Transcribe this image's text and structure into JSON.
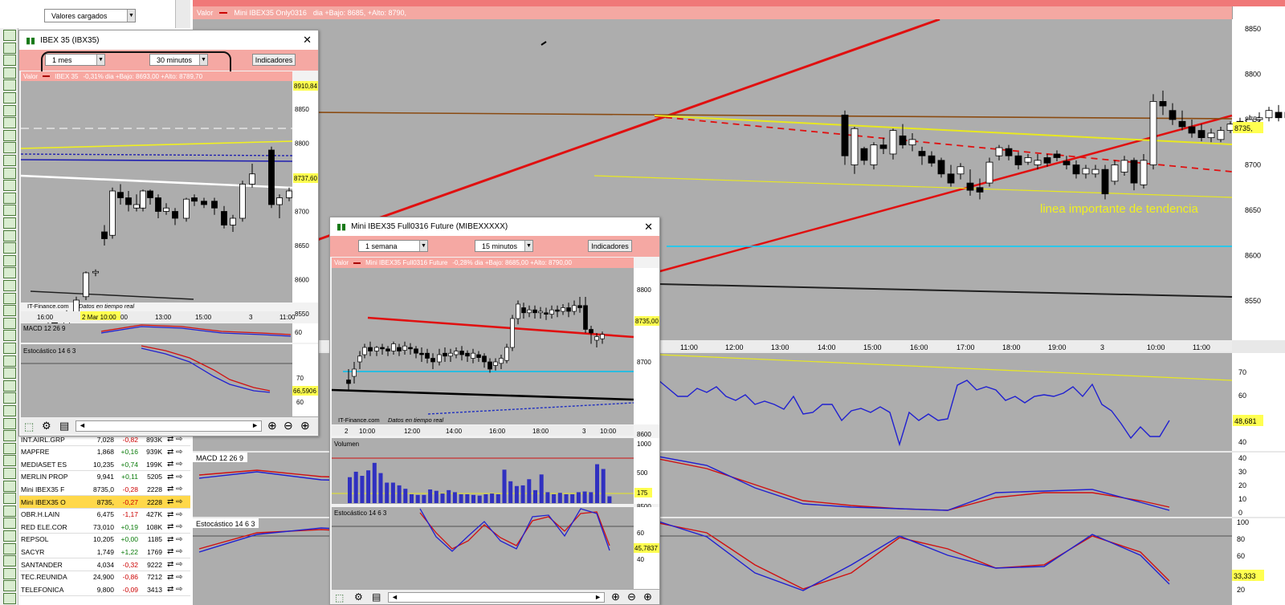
{
  "toolbar": {
    "dropdown": "Valores cargados"
  },
  "main": {
    "header": "Valor",
    "instrument": "Mini IBEX35 Only0316",
    "header_stats": "dia +Bajo: 8685, +Alto: 8790,",
    "annotation": "linea importante de tendencia",
    "price_tag": "8735,",
    "osc_tag": "48,681",
    "stoch_tag": "33,333",
    "y_ticks": [
      "8850",
      "8800",
      "8750",
      "8700",
      "8650",
      "8600",
      "8550"
    ],
    "x_ticks": [
      "11:00",
      "12:00",
      "13:00",
      "14:00",
      "15:00",
      "16:00",
      "17:00",
      "18:00",
      "19:00",
      "3",
      "10:00",
      "11:00"
    ],
    "osc_ticks": [
      "70",
      "60",
      "50",
      "40"
    ],
    "macd_label": "MACD 12 26 9",
    "macd_ticks": [
      "40",
      "30",
      "20",
      "10",
      "0"
    ],
    "stoch_label": "Estocástico 14 6 3",
    "stoch_ticks": [
      "100",
      "80",
      "60",
      "40",
      "20"
    ],
    "candles": [
      [
        812,
        8755,
        8710,
        8700,
        8760
      ],
      [
        824,
        8700,
        8740,
        8690,
        8742
      ],
      [
        836,
        8718,
        8705,
        8700,
        8720
      ],
      [
        848,
        8700,
        8722,
        8695,
        8725
      ],
      [
        860,
        8722,
        8718,
        8712,
        8730
      ],
      [
        872,
        8712,
        8738,
        8706,
        8740
      ],
      [
        884,
        8732,
        8722,
        8718,
        8745
      ],
      [
        896,
        8722,
        8728,
        8715,
        8735
      ],
      [
        908,
        8715,
        8710,
        8700,
        8720
      ],
      [
        920,
        8710,
        8702,
        8698,
        8715
      ],
      [
        932,
        8705,
        8690,
        8686,
        8708
      ],
      [
        944,
        8690,
        8680,
        8676,
        8700
      ],
      [
        956,
        8690,
        8698,
        8684,
        8702
      ],
      [
        968,
        8680,
        8672,
        8666,
        8695
      ],
      [
        980,
        8675,
        8670,
        8662,
        8685
      ],
      [
        992,
        8680,
        8703,
        8676,
        8708
      ],
      [
        1004,
        8710,
        8719,
        8705,
        8722
      ],
      [
        1016,
        8718,
        8710,
        8705,
        8722
      ],
      [
        1028,
        8710,
        8700,
        8695,
        8714
      ],
      [
        1040,
        8703,
        8708,
        8700,
        8712
      ],
      [
        1052,
        8700,
        8705,
        8695,
        8712
      ],
      [
        1064,
        8708,
        8702,
        8698,
        8712
      ],
      [
        1076,
        8712,
        8708,
        8704,
        8716
      ],
      [
        1088,
        8704,
        8700,
        8695,
        8710
      ],
      [
        1100,
        8700,
        8690,
        8685,
        8705
      ],
      [
        1112,
        8690,
        8696,
        8685,
        8700
      ],
      [
        1124,
        8690,
        8695,
        8686,
        8700
      ],
      [
        1136,
        8695,
        8668,
        8662,
        8700
      ],
      [
        1148,
        8682,
        8700,
        8678,
        8705
      ],
      [
        1160,
        8692,
        8705,
        8688,
        8710
      ],
      [
        1172,
        8705,
        8680,
        8672,
        8708
      ],
      [
        1184,
        8678,
        8705,
        8674,
        8712
      ],
      [
        1196,
        8700,
        8770,
        8695,
        8778
      ],
      [
        1208,
        8770,
        8765,
        8755,
        8782
      ],
      [
        1220,
        8760,
        8750,
        8744,
        8768
      ],
      [
        1232,
        8748,
        8742,
        8738,
        8760
      ],
      [
        1244,
        8742,
        8735,
        8730,
        8750
      ],
      [
        1256,
        8738,
        8730,
        8726,
        8745
      ],
      [
        1268,
        8730,
        8735,
        8725,
        8740
      ],
      [
        1280,
        8728,
        8738,
        8725,
        8742
      ],
      [
        1292,
        8738,
        8745,
        8735,
        8748
      ],
      [
        1304,
        8748,
        8745,
        8740,
        8752
      ],
      [
        1316,
        8745,
        8750,
        8740,
        8755
      ],
      [
        1328,
        8750,
        8752,
        8745,
        8758
      ],
      [
        1340,
        8752,
        8760,
        8748,
        8764
      ],
      [
        1352,
        8758,
        8752,
        8748,
        8766
      ],
      [
        1364,
        8752,
        8758,
        8748,
        8765
      ],
      [
        1376,
        8766,
        8748,
        8742,
        8790
      ],
      [
        1388,
        8748,
        8720,
        8700,
        8752
      ],
      [
        1400,
        8720,
        8712,
        8700,
        8726
      ],
      [
        1412,
        8710,
        8725,
        8705,
        8730
      ],
      [
        1424,
        8725,
        8720,
        8690,
        8728
      ],
      [
        1436,
        8715,
        8735,
        8712,
        8738
      ]
    ]
  },
  "sidebar": {
    "icons": 46,
    "rows": [
      {
        "name": "INT.AIRL.GRP",
        "price": "7,028",
        "chg": "-0,82",
        "vol": "893K"
      },
      {
        "name": "MAPFRE",
        "price": "1,868",
        "chg": "+0,16",
        "vol": "939K"
      },
      {
        "name": "MEDIASET ES",
        "price": "10,235",
        "chg": "+0,74",
        "vol": "199K"
      },
      {
        "name": "MERLIN PROP",
        "price": "9,941",
        "chg": "+0,11",
        "vol": "5205"
      },
      {
        "name": "Mini IBEX35 F",
        "price": "8735,0",
        "chg": "-0,28",
        "vol": "2228"
      },
      {
        "name": "Mini IBEX35 O",
        "price": "8735,",
        "chg": "-0,27",
        "vol": "2228"
      },
      {
        "name": "OBR.H.LAIN",
        "price": "6,475",
        "chg": "-1,17",
        "vol": "427K"
      },
      {
        "name": "RED ELE.COR",
        "price": "73,010",
        "chg": "+0,19",
        "vol": "108K"
      },
      {
        "name": "REPSOL",
        "price": "10,205",
        "chg": "+0,00",
        "vol": "1185"
      },
      {
        "name": "SACYR",
        "price": "1,749",
        "chg": "+1,22",
        "vol": "1769"
      },
      {
        "name": "SANTANDER",
        "price": "4,034",
        "chg": "-0,32",
        "vol": "9222"
      },
      {
        "name": "TEC.REUNIDA",
        "price": "24,900",
        "chg": "-0,86",
        "vol": "7212"
      },
      {
        "name": "TELEFONICA",
        "price": "9,800",
        "chg": "-0,09",
        "vol": "3413"
      }
    ]
  },
  "win1": {
    "title": "IBEX 35 (IBX35)",
    "period": "1 mes",
    "interval": "30 minutos",
    "indicators": "Indicadores",
    "header": "Valor",
    "instrument": "IBEX 35",
    "stats": "-0,31%  dia +Bajo: 8693,00 +Alto: 8789,70",
    "tag_top": "8910,84",
    "tag_price": "8737,60",
    "y_ticks": [
      "8850",
      "8800",
      "8750",
      "8700",
      "8650",
      "8600",
      "8550"
    ],
    "credit": "IT-Finance.com",
    "credit2": "Datos en tiempo real",
    "x_ticks": [
      "16:00",
      "2 Mar 10:00",
      "00",
      "13:00",
      "15:00",
      "3",
      "11:00"
    ],
    "macd_label": "MACD 12 26 9",
    "macd_tick": "60",
    "stoch_label": "Estocástico 14 6 3",
    "stoch_ticks": [
      "70",
      "60"
    ],
    "stoch_tag": "66,5906",
    "candles": [
      [
        34,
        8545,
        8540,
        8530,
        8550
      ],
      [
        42,
        8540,
        8535,
        8525,
        8545
      ],
      [
        57,
        8535,
        8550,
        8530,
        8555
      ],
      [
        69,
        8550,
        8570,
        8545,
        8575
      ],
      [
        81,
        8575,
        8610,
        8570,
        8612
      ],
      [
        93,
        8610,
        8612,
        8605,
        8615
      ],
      [
        104,
        8670,
        8660,
        8650,
        8680
      ],
      [
        114,
        8665,
        8730,
        8660,
        8735
      ],
      [
        124,
        8728,
        8720,
        8710,
        8740
      ],
      [
        134,
        8720,
        8710,
        8700,
        8730
      ],
      [
        144,
        8705,
        8710,
        8700,
        8725
      ],
      [
        152,
        8705,
        8730,
        8700,
        8732
      ],
      [
        161,
        8730,
        8720,
        8710,
        8732
      ],
      [
        171,
        8720,
        8700,
        8690,
        8725
      ],
      [
        181,
        8700,
        8705,
        8695,
        8712
      ],
      [
        192,
        8700,
        8690,
        8680,
        8705
      ],
      [
        206,
        8690,
        8718,
        8685,
        8720
      ],
      [
        216,
        8720,
        8715,
        8708,
        8725
      ],
      [
        228,
        8715,
        8710,
        8705,
        8720
      ],
      [
        241,
        8715,
        8705,
        8695,
        8720
      ],
      [
        253,
        8700,
        8680,
        8675,
        8708
      ],
      [
        264,
        8680,
        8690,
        8670,
        8695
      ],
      [
        276,
        8690,
        8740,
        8685,
        8745
      ],
      [
        288,
        8740,
        8755,
        8735,
        8770
      ],
      [
        312,
        8790,
        8710,
        8705,
        8795
      ],
      [
        322,
        8710,
        8720,
        8690,
        8725
      ],
      [
        334,
        8720,
        8730,
        8715,
        8735
      ]
    ]
  },
  "win2": {
    "title": "Mini IBEX35 Full0316 Future (MIBEXXXXX)",
    "period": "1 semana",
    "interval": "15 minutos",
    "indicators": "Indicadores",
    "header": "Valor",
    "instrument": "Mini IBEX35 Full0316 Future",
    "stats": "-0,28%  dia +Bajo: 8685,00 +Alto: 8790,00",
    "tag_price": "8735,00",
    "y_ticks": [
      "8800",
      "8700",
      "8600",
      "8500"
    ],
    "credit": "IT-Finance.com",
    "credit2": "Datos en tiempo real",
    "x_ticks": [
      "2",
      "10:00",
      "12:00",
      "14:00",
      "16:00",
      "18:00",
      "3",
      "10:00"
    ],
    "vol_label": "Volumen",
    "vol_ticks": [
      "1000",
      "500",
      "175"
    ],
    "volumes": [
      380,
      460,
      400,
      480,
      590,
      440,
      300,
      300,
      260,
      210,
      130,
      120,
      120,
      200,
      180,
      140,
      190,
      160,
      130,
      130,
      120,
      110,
      130,
      140,
      130,
      490,
      320,
      250,
      260,
      350,
      190,
      420,
      160,
      130,
      150,
      130,
      130,
      160,
      170,
      160,
      570,
      500,
      100
    ],
    "stoch_label": "Estocástico 14 6 3",
    "stoch_ticks": [
      "60",
      "40"
    ],
    "stoch_tag": "45,7837",
    "candles": [
      [
        433,
        8675,
        8670,
        8660,
        8690
      ],
      [
        440,
        8680,
        8690,
        8670,
        8700
      ],
      [
        447,
        8700,
        8708,
        8690,
        8715
      ],
      [
        453,
        8710,
        8720,
        8705,
        8725
      ],
      [
        460,
        8720,
        8715,
        8708,
        8728
      ],
      [
        468,
        8715,
        8720,
        8708,
        8722
      ],
      [
        475,
        8720,
        8718,
        8710,
        8725
      ],
      [
        482,
        8718,
        8715,
        8708,
        8722
      ],
      [
        489,
        8715,
        8725,
        8710,
        8728
      ],
      [
        496,
        8720,
        8715,
        8708,
        8725
      ],
      [
        503,
        8716,
        8722,
        8710,
        8728
      ],
      [
        510,
        8720,
        8718,
        8710,
        8726
      ],
      [
        517,
        8718,
        8712,
        8705,
        8722
      ],
      [
        524,
        8712,
        8710,
        8700,
        8720
      ],
      [
        531,
        8712,
        8705,
        8698,
        8718
      ],
      [
        538,
        8705,
        8700,
        8690,
        8712
      ],
      [
        546,
        8700,
        8710,
        8695,
        8718
      ],
      [
        553,
        8712,
        8708,
        8700,
        8720
      ],
      [
        560,
        8708,
        8712,
        8700,
        8718
      ],
      [
        567,
        8710,
        8715,
        8705,
        8720
      ],
      [
        574,
        8715,
        8710,
        8702,
        8722
      ],
      [
        581,
        8712,
        8708,
        8700,
        8716
      ],
      [
        588,
        8705,
        8712,
        8698,
        8718
      ],
      [
        595,
        8710,
        8706,
        8700,
        8715
      ],
      [
        602,
        8708,
        8700,
        8692,
        8712
      ],
      [
        609,
        8700,
        8690,
        8685,
        8705
      ],
      [
        616,
        8695,
        8700,
        8688,
        8705
      ],
      [
        623,
        8698,
        8705,
        8690,
        8710
      ],
      [
        630,
        8702,
        8720,
        8698,
        8725
      ],
      [
        637,
        8720,
        8760,
        8715,
        8765
      ],
      [
        644,
        8760,
        8780,
        8752,
        8785
      ],
      [
        651,
        8775,
        8768,
        8760,
        8782
      ],
      [
        658,
        8768,
        8772,
        8762,
        8778
      ],
      [
        665,
        8772,
        8768,
        8760,
        8778
      ],
      [
        672,
        8768,
        8770,
        8760,
        8776
      ],
      [
        679,
        8768,
        8766,
        8758,
        8775
      ],
      [
        686,
        8766,
        8772,
        8760,
        8778
      ],
      [
        693,
        8772,
        8770,
        8762,
        8778
      ],
      [
        700,
        8770,
        8775,
        8765,
        8780
      ],
      [
        707,
        8775,
        8770,
        8762,
        8782
      ],
      [
        714,
        8770,
        8778,
        8765,
        8785
      ],
      [
        721,
        8778,
        8775,
        8768,
        8790
      ],
      [
        728,
        8778,
        8745,
        8740,
        8790
      ],
      [
        735,
        8745,
        8740,
        8725,
        8750
      ],
      [
        742,
        8730,
        8735,
        8720,
        8740
      ],
      [
        749,
        8732,
        8738,
        8725,
        8742
      ]
    ]
  },
  "bottom_btns": [
    "◄",
    "►"
  ]
}
